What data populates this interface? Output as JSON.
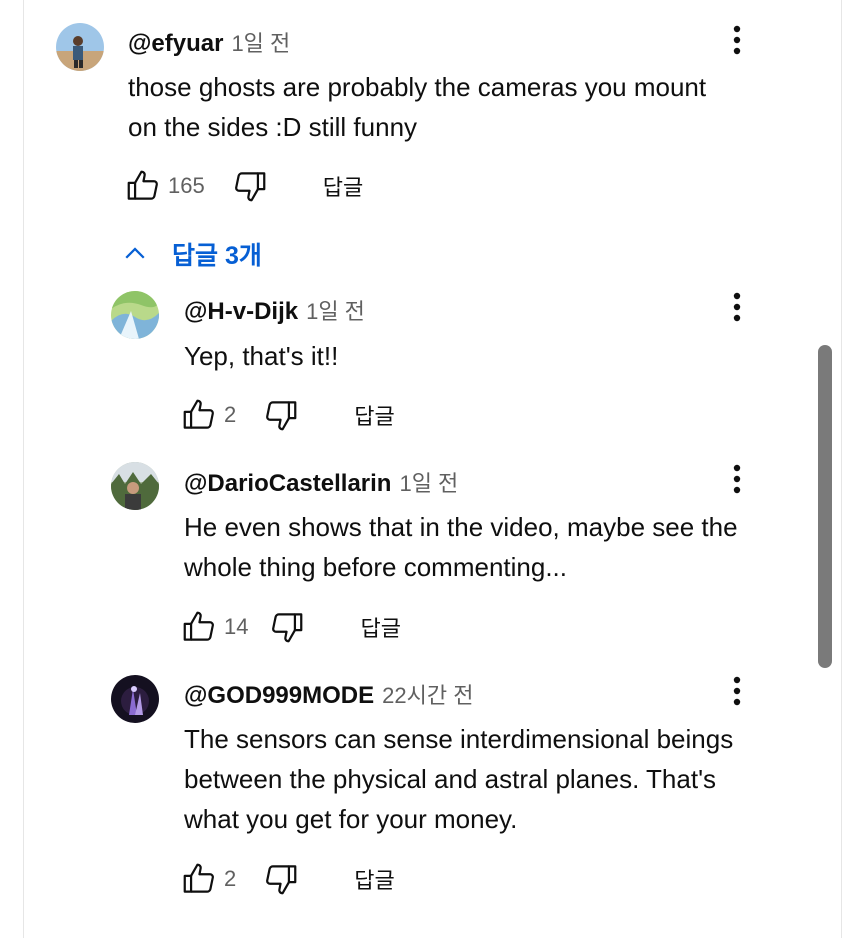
{
  "thread": {
    "author": "@efyuar",
    "time": "1일 전",
    "text_lines": [
      "those ghosts are probably the cameras you mount",
      "on the sides :D still funny"
    ],
    "likes": "165",
    "reply_label": "답글",
    "replies_toggle": "답글 3개"
  },
  "replies": [
    {
      "author": "@H-v-Dijk",
      "time": "1일 전",
      "text_lines": [
        "Yep, that's it!!"
      ],
      "likes": "2",
      "reply_label": "답글"
    },
    {
      "author": "@DarioCastellarin",
      "time": "1일 전",
      "text_lines": [
        "He even shows that in the video, maybe see the",
        "whole thing before commenting..."
      ],
      "likes": "14",
      "reply_label": "답글"
    },
    {
      "author": "@GOD999MODE",
      "time": "22시간 전",
      "text_lines": [
        "The sensors can sense interdimensional beings",
        "between the physical and astral planes. That's",
        "what you get for your money."
      ],
      "likes": "2",
      "reply_label": "답글"
    }
  ],
  "colors": {
    "link_blue": "#065fd4",
    "meta_gray": "#606060",
    "scrollbar": "#7a7a7a"
  },
  "icons": [
    "thumb-up-icon",
    "thumb-down-icon",
    "more-vert-icon",
    "chevron-up-icon"
  ]
}
